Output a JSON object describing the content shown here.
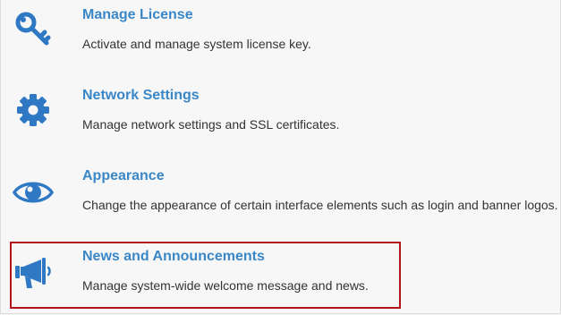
{
  "colors": {
    "accent": "#3a87c8",
    "icon": "#2f78c4",
    "highlight_border": "#b3141c",
    "text": "#333333"
  },
  "settings_items": [
    {
      "icon": "key-icon",
      "title": "Manage License",
      "description": "Activate and manage system license key."
    },
    {
      "icon": "gear-icon",
      "title": "Network Settings",
      "description": "Manage network settings and SSL certificates."
    },
    {
      "icon": "eye-icon",
      "title": "Appearance",
      "description": "Change the appearance of certain interface elements such as login and banner logos."
    },
    {
      "icon": "megaphone-icon",
      "title": "News and Announcements",
      "description": "Manage system-wide welcome message and news."
    }
  ]
}
